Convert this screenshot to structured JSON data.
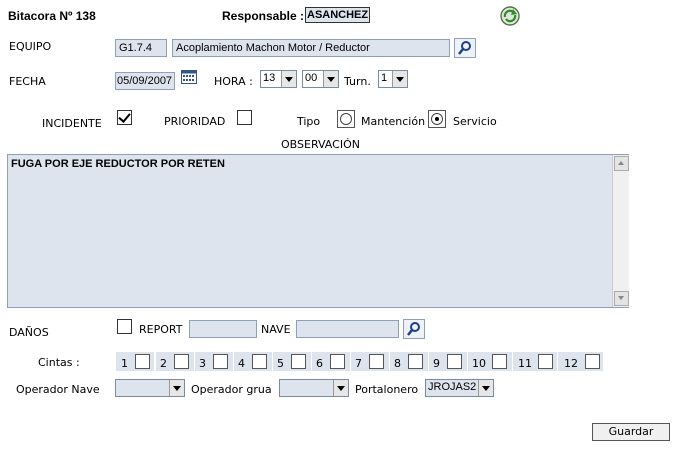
{
  "header": {
    "bitacora_label": "Bitacora Nº 138",
    "responsable_label": "Responsable :",
    "responsable_value": "ASANCHEZ"
  },
  "equipo": {
    "label": "EQUIPO",
    "code": "G1.7.4",
    "description": "Acoplamiento Machon Motor / Reductor"
  },
  "fecha": {
    "label": "FECHA",
    "value": "05/09/2007"
  },
  "hora": {
    "label": "HORA :",
    "hour": "13",
    "minute": "00"
  },
  "turno": {
    "label": "Turn.",
    "value": "1"
  },
  "incidente": {
    "label": "INCIDENTE",
    "checked": true
  },
  "prioridad": {
    "label": "PRIORIDAD",
    "checked": false
  },
  "tipo": {
    "label": "Tipo",
    "options": [
      "Mantención",
      "Servicio"
    ],
    "selected": "Servicio"
  },
  "observacion": {
    "label": "OBSERVACIÓN",
    "text": "FUGA POR EJE REDUCTOR POR RETEN"
  },
  "danos": {
    "label": "DAÑOS",
    "report_label": "REPORT",
    "report_value": "",
    "nave_label": "NAVE",
    "nave_value": ""
  },
  "cintas": {
    "label": "Cintas :",
    "numbers": [
      "1",
      "2",
      "3",
      "4",
      "5",
      "6",
      "7",
      "8",
      "9",
      "10",
      "11",
      "12"
    ]
  },
  "operadores": {
    "operador_nave_label": "Operador Nave",
    "operador_nave_value": "",
    "operador_grua_label": "Operador grua",
    "operador_grua_value": "",
    "portalonero_label": "Portalonero",
    "portalonero_value": "JROJAS2"
  },
  "actions": {
    "guardar_label": "Guardar"
  },
  "icons": {
    "refresh": "refresh-icon",
    "search": "search-icon",
    "calendar": "calendar-icon"
  }
}
